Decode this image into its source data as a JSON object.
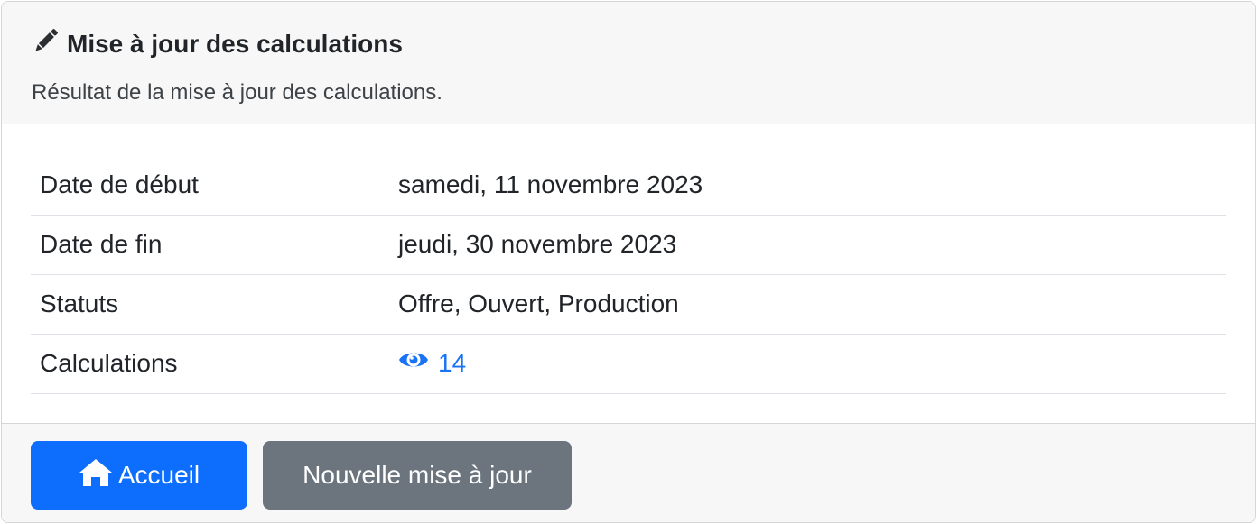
{
  "header": {
    "icon": "pencil-icon",
    "title": "Mise à jour des calculations",
    "subtitle": "Résultat de la mise à jour des calculations."
  },
  "details": [
    {
      "label": "Date de début",
      "value": "samedi, 11 novembre 2023"
    },
    {
      "label": "Date de fin",
      "value": "jeudi, 30 novembre 2023"
    },
    {
      "label": "Statuts",
      "value": "Offre, Ouvert, Production"
    },
    {
      "label": "Calculations",
      "value": "14",
      "icon": "eye-icon"
    }
  ],
  "footer": {
    "home_label": "Accueil",
    "home_icon": "home-icon",
    "new_update_label": "Nouvelle mise à jour"
  },
  "colors": {
    "primary": "#0d6efd",
    "secondary": "#6c757d",
    "link": "#1a73f5",
    "header_bg": "#f7f7f7"
  }
}
